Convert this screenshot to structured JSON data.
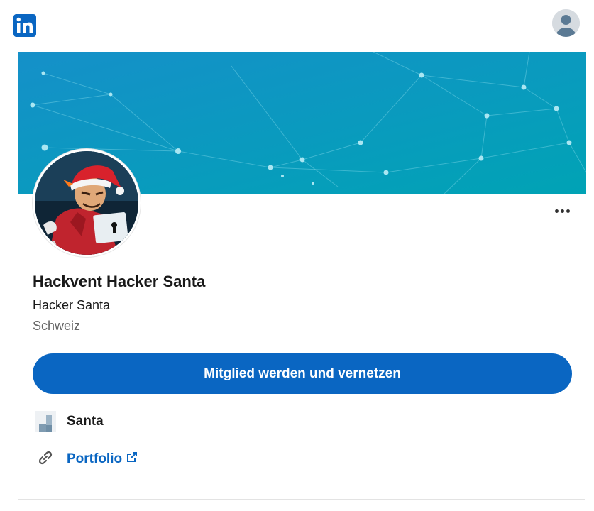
{
  "header": {
    "logo_icon": "linkedin-logo-icon",
    "user_icon": "user-avatar-icon"
  },
  "profile": {
    "name": "Hackvent Hacker Santa",
    "headline": "Hacker Santa",
    "location": "Schweiz",
    "more_icon": "more-options-icon"
  },
  "actions": {
    "join_label": "Mitglied werden und vernetzen"
  },
  "company": {
    "name": "Santa",
    "icon": "company-logo-icon"
  },
  "links": {
    "portfolio_label": "Portfolio",
    "link_icon": "link-icon",
    "external_icon": "external-link-icon"
  },
  "colors": {
    "brand_blue": "#0a66c2",
    "banner_start": "#1590c9",
    "banner_end": "#00a0b6"
  }
}
